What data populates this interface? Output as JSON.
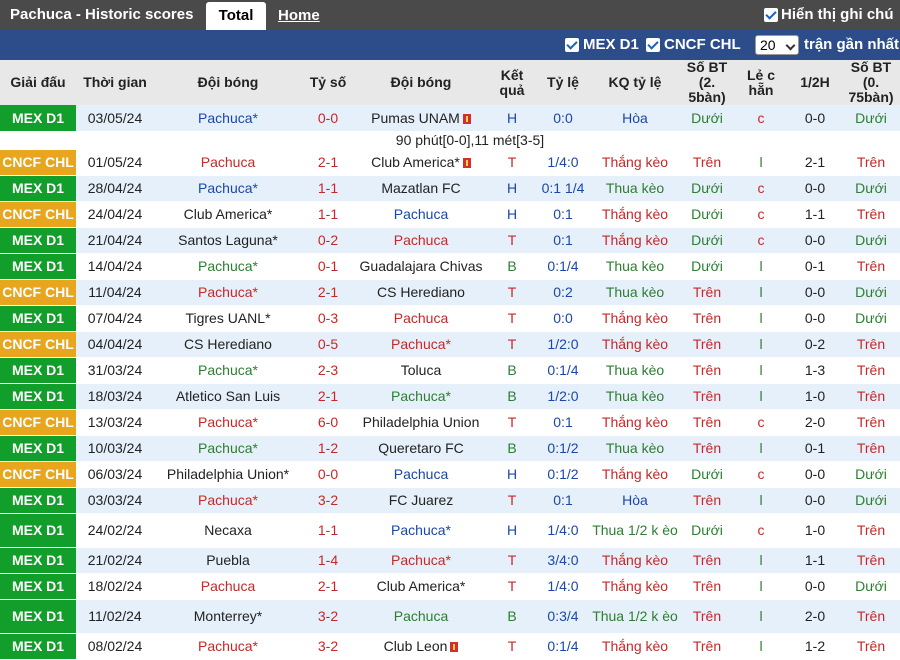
{
  "topbar": {
    "title": "Pachuca - Historic scores",
    "tab_total": "Total",
    "tab_home": "Home",
    "show_label": "Hiển thị ghi chú"
  },
  "filters": {
    "mex": "MEX D1",
    "cncf": "CNCF CHL",
    "count": "20",
    "recent_label": "trận gần nhất"
  },
  "headers": {
    "league": "Giải đấu",
    "time": "Thời gian",
    "home": "Đội bóng",
    "score": "Tỷ số",
    "away": "Đội bóng",
    "result": "Kết quả",
    "odds": "Tỷ lệ",
    "odds_result": "KQ tỷ lệ",
    "goals25": "Số BT (2. 5bàn)",
    "oddeven": "Lẻ c hẵn",
    "half": "1/2H",
    "goals075": "Số BT (0. 75bàn)"
  },
  "colors": {
    "mex": "#129e2a",
    "cncf": "#e8a51e",
    "red": "#c62828",
    "blue": "#1a47a8",
    "green": "#2e7d32"
  },
  "rows": [
    {
      "comp": "MEX D1",
      "type": "mex",
      "date": "03/05/24",
      "home": "Pachuca*",
      "home_c": "blue",
      "score": "0-0",
      "away": "Pumas UNAM",
      "away_c": "",
      "away_card": true,
      "res": "H",
      "res_c": "blue",
      "odds": "0:0",
      "kq": "Hòa",
      "kq_c": "blue",
      "bt": "Dưới",
      "bt_c": "green",
      "le": "c",
      "le_c": "red",
      "half": "0-0",
      "bt2": "Dưới",
      "bt2_c": "green"
    },
    {
      "comp": "CNCF CHL",
      "type": "cncf",
      "date": "01/05/24",
      "home": "Pachuca",
      "home_c": "red",
      "score": "2-1",
      "away": "Club America*",
      "away_c": "",
      "away_card": true,
      "res": "T",
      "res_c": "red",
      "odds": "1/4:0",
      "kq": "Thắng kèo",
      "kq_c": "red",
      "bt": "Trên",
      "bt_c": "red",
      "le": "l",
      "le_c": "green",
      "half": "2-1",
      "bt2": "Trên",
      "bt2_c": "red"
    },
    {
      "comp": "MEX D1",
      "type": "mex",
      "date": "28/04/24",
      "home": "Pachuca*",
      "home_c": "blue",
      "score": "1-1",
      "away": "Mazatlan FC",
      "away_c": "",
      "res": "H",
      "res_c": "blue",
      "odds": "0:1 1/4",
      "kq": "Thua kèo",
      "kq_c": "green",
      "bt": "Dưới",
      "bt_c": "green",
      "le": "c",
      "le_c": "red",
      "half": "0-0",
      "bt2": "Dưới",
      "bt2_c": "green"
    },
    {
      "comp": "CNCF CHL",
      "type": "cncf",
      "date": "24/04/24",
      "home": "Club America*",
      "home_c": "",
      "score": "1-1",
      "away": "Pachuca",
      "away_c": "blue",
      "res": "H",
      "res_c": "blue",
      "odds": "0:1",
      "kq": "Thắng kèo",
      "kq_c": "red",
      "bt": "Dưới",
      "bt_c": "green",
      "le": "c",
      "le_c": "red",
      "half": "1-1",
      "bt2": "Trên",
      "bt2_c": "red"
    },
    {
      "comp": "MEX D1",
      "type": "mex",
      "date": "21/04/24",
      "home": "Santos Laguna*",
      "home_c": "",
      "score": "0-2",
      "away": "Pachuca",
      "away_c": "red",
      "res": "T",
      "res_c": "red",
      "odds": "0:1",
      "kq": "Thắng kèo",
      "kq_c": "red",
      "bt": "Dưới",
      "bt_c": "green",
      "le": "c",
      "le_c": "red",
      "half": "0-0",
      "bt2": "Dưới",
      "bt2_c": "green"
    },
    {
      "comp": "MEX D1",
      "type": "mex",
      "date": "14/04/24",
      "home": "Pachuca*",
      "home_c": "green",
      "score": "0-1",
      "away": "Guadalajara Chivas",
      "away_c": "",
      "res": "B",
      "res_c": "green",
      "odds": "0:1/4",
      "kq": "Thua kèo",
      "kq_c": "green",
      "bt": "Dưới",
      "bt_c": "green",
      "le": "l",
      "le_c": "green",
      "half": "0-1",
      "bt2": "Trên",
      "bt2_c": "red"
    },
    {
      "comp": "CNCF CHL",
      "type": "cncf",
      "date": "11/04/24",
      "home": "Pachuca*",
      "home_c": "red",
      "score": "2-1",
      "away": "CS Herediano",
      "away_c": "",
      "res": "T",
      "res_c": "red",
      "odds": "0:2",
      "kq": "Thua kèo",
      "kq_c": "green",
      "bt": "Trên",
      "bt_c": "red",
      "le": "l",
      "le_c": "green",
      "half": "0-0",
      "bt2": "Dưới",
      "bt2_c": "green"
    },
    {
      "comp": "MEX D1",
      "type": "mex",
      "date": "07/04/24",
      "home": "Tigres UANL*",
      "home_c": "",
      "score": "0-3",
      "away": "Pachuca",
      "away_c": "red",
      "res": "T",
      "res_c": "red",
      "odds": "0:0",
      "kq": "Thắng kèo",
      "kq_c": "red",
      "bt": "Trên",
      "bt_c": "red",
      "le": "l",
      "le_c": "green",
      "half": "0-0",
      "bt2": "Dưới",
      "bt2_c": "green"
    },
    {
      "comp": "CNCF CHL",
      "type": "cncf",
      "date": "04/04/24",
      "home": "CS Herediano",
      "home_c": "",
      "score": "0-5",
      "away": "Pachuca*",
      "away_c": "red",
      "res": "T",
      "res_c": "red",
      "odds": "1/2:0",
      "kq": "Thắng kèo",
      "kq_c": "red",
      "bt": "Trên",
      "bt_c": "red",
      "le": "l",
      "le_c": "green",
      "half": "0-2",
      "bt2": "Trên",
      "bt2_c": "red"
    },
    {
      "comp": "MEX D1",
      "type": "mex",
      "date": "31/03/24",
      "home": "Pachuca*",
      "home_c": "green",
      "score": "2-3",
      "away": "Toluca",
      "away_c": "",
      "res": "B",
      "res_c": "green",
      "odds": "0:1/4",
      "kq": "Thua kèo",
      "kq_c": "green",
      "bt": "Trên",
      "bt_c": "red",
      "le": "l",
      "le_c": "green",
      "half": "1-3",
      "bt2": "Trên",
      "bt2_c": "red"
    },
    {
      "comp": "MEX D1",
      "type": "mex",
      "date": "18/03/24",
      "home": "Atletico San Luis",
      "home_c": "",
      "score": "2-1",
      "away": "Pachuca*",
      "away_c": "green",
      "res": "B",
      "res_c": "green",
      "odds": "1/2:0",
      "kq": "Thua kèo",
      "kq_c": "green",
      "bt": "Trên",
      "bt_c": "red",
      "le": "l",
      "le_c": "green",
      "half": "1-0",
      "bt2": "Trên",
      "bt2_c": "red"
    },
    {
      "comp": "CNCF CHL",
      "type": "cncf",
      "date": "13/03/24",
      "home": "Pachuca*",
      "home_c": "red",
      "score": "6-0",
      "away": "Philadelphia Union",
      "away_c": "",
      "res": "T",
      "res_c": "red",
      "odds": "0:1",
      "kq": "Thắng kèo",
      "kq_c": "red",
      "bt": "Trên",
      "bt_c": "red",
      "le": "c",
      "le_c": "red",
      "half": "2-0",
      "bt2": "Trên",
      "bt2_c": "red"
    },
    {
      "comp": "MEX D1",
      "type": "mex",
      "date": "10/03/24",
      "home": "Pachuca*",
      "home_c": "green",
      "score": "1-2",
      "away": "Queretaro FC",
      "away_c": "",
      "res": "B",
      "res_c": "green",
      "odds": "0:1/2",
      "kq": "Thua kèo",
      "kq_c": "green",
      "bt": "Trên",
      "bt_c": "red",
      "le": "l",
      "le_c": "green",
      "half": "0-1",
      "bt2": "Trên",
      "bt2_c": "red"
    },
    {
      "comp": "CNCF CHL",
      "type": "cncf",
      "date": "06/03/24",
      "home": "Philadelphia Union*",
      "home_c": "",
      "score": "0-0",
      "away": "Pachuca",
      "away_c": "blue",
      "res": "H",
      "res_c": "blue",
      "odds": "0:1/2",
      "kq": "Thắng kèo",
      "kq_c": "red",
      "bt": "Dưới",
      "bt_c": "green",
      "le": "c",
      "le_c": "red",
      "half": "0-0",
      "bt2": "Dưới",
      "bt2_c": "green"
    },
    {
      "comp": "MEX D1",
      "type": "mex",
      "date": "03/03/24",
      "home": "Pachuca*",
      "home_c": "red",
      "score": "3-2",
      "away": "FC Juarez",
      "away_c": "",
      "res": "T",
      "res_c": "red",
      "odds": "0:1",
      "kq": "Hòa",
      "kq_c": "blue",
      "bt": "Trên",
      "bt_c": "red",
      "le": "l",
      "le_c": "green",
      "half": "0-0",
      "bt2": "Dưới",
      "bt2_c": "green"
    },
    {
      "comp": "MEX D1",
      "type": "mex",
      "date": "24/02/24",
      "home": "Necaxa",
      "home_c": "",
      "score": "1-1",
      "away": "Pachuca*",
      "away_c": "blue",
      "res": "H",
      "res_c": "blue",
      "odds": "1/4:0",
      "kq": "Thua 1/2 k èo",
      "kq_c": "green",
      "kq_wrap": true,
      "bt": "Dưới",
      "bt_c": "green",
      "le": "c",
      "le_c": "red",
      "half": "1-0",
      "bt2": "Trên",
      "bt2_c": "red",
      "tall": true
    },
    {
      "comp": "MEX D1",
      "type": "mex",
      "date": "21/02/24",
      "home": "Puebla",
      "home_c": "",
      "score": "1-4",
      "away": "Pachuca*",
      "away_c": "red",
      "res": "T",
      "res_c": "red",
      "odds": "3/4:0",
      "kq": "Thắng kèo",
      "kq_c": "red",
      "bt": "Trên",
      "bt_c": "red",
      "le": "l",
      "le_c": "green",
      "half": "1-1",
      "bt2": "Trên",
      "bt2_c": "red"
    },
    {
      "comp": "MEX D1",
      "type": "mex",
      "date": "18/02/24",
      "home": "Pachuca",
      "home_c": "red",
      "score": "2-1",
      "away": "Club America*",
      "away_c": "",
      "res": "T",
      "res_c": "red",
      "odds": "1/4:0",
      "kq": "Thắng kèo",
      "kq_c": "red",
      "bt": "Trên",
      "bt_c": "red",
      "le": "l",
      "le_c": "green",
      "half": "0-0",
      "bt2": "Dưới",
      "bt2_c": "green"
    },
    {
      "comp": "MEX D1",
      "type": "mex",
      "date": "11/02/24",
      "home": "Monterrey*",
      "home_c": "",
      "score": "3-2",
      "away": "Pachuca",
      "away_c": "green",
      "res": "B",
      "res_c": "green",
      "odds": "0:3/4",
      "kq": "Thua 1/2 k èo",
      "kq_c": "green",
      "kq_wrap": true,
      "bt": "Trên",
      "bt_c": "red",
      "le": "l",
      "le_c": "green",
      "half": "2-0",
      "bt2": "Trên",
      "bt2_c": "red",
      "tall": true
    },
    {
      "comp": "MEX D1",
      "type": "mex",
      "date": "08/02/24",
      "home": "Pachuca*",
      "home_c": "red",
      "score": "3-2",
      "away": "Club Leon",
      "away_c": "",
      "away_card": true,
      "res": "T",
      "res_c": "red",
      "odds": "0:1/4",
      "kq": "Thắng kèo",
      "kq_c": "red",
      "bt": "Trên",
      "bt_c": "red",
      "le": "l",
      "le_c": "green",
      "half": "1-2",
      "bt2": "Trên",
      "bt2_c": "red"
    }
  ],
  "note_after_first": "90 phút[0-0],11 mét[3-5]"
}
